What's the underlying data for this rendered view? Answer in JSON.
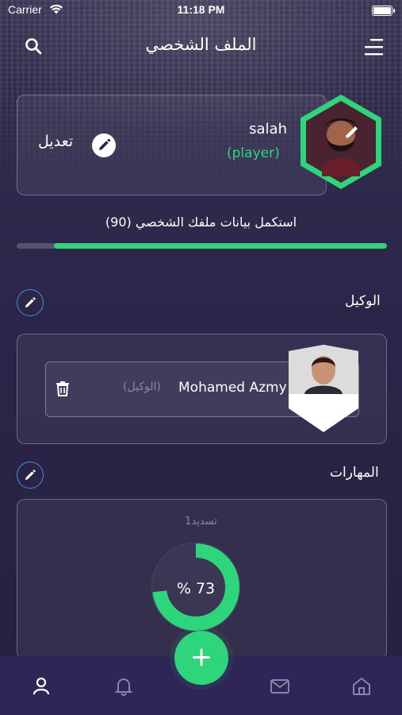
{
  "status_bar": {
    "carrier": "Carrier",
    "time": "11:18 PM"
  },
  "header": {
    "title": "الملف الشخصي"
  },
  "profile": {
    "name": "salah",
    "role": "(player)",
    "edit_label": "تعديل"
  },
  "completeness": {
    "label": "استكمل بيانات ملفك الشخصي (90)",
    "value_percent": 90
  },
  "agent_section": {
    "title": "الوكيل",
    "agent_name": "Mohamed Azmy",
    "agent_role": "(الوكيل)"
  },
  "skills_section": {
    "title": "المهارات",
    "skill_name": "تسديد1",
    "skill_value_label": "% 73",
    "skill_value_percent": 73
  },
  "bottom_nav": {
    "items": [
      "profile-icon",
      "bell-icon",
      "add-icon",
      "mail-icon",
      "home-icon"
    ]
  },
  "colors": {
    "accent": "#2ed57a",
    "edit_ring": "#3f8fe8",
    "background": "#2b2447"
  }
}
